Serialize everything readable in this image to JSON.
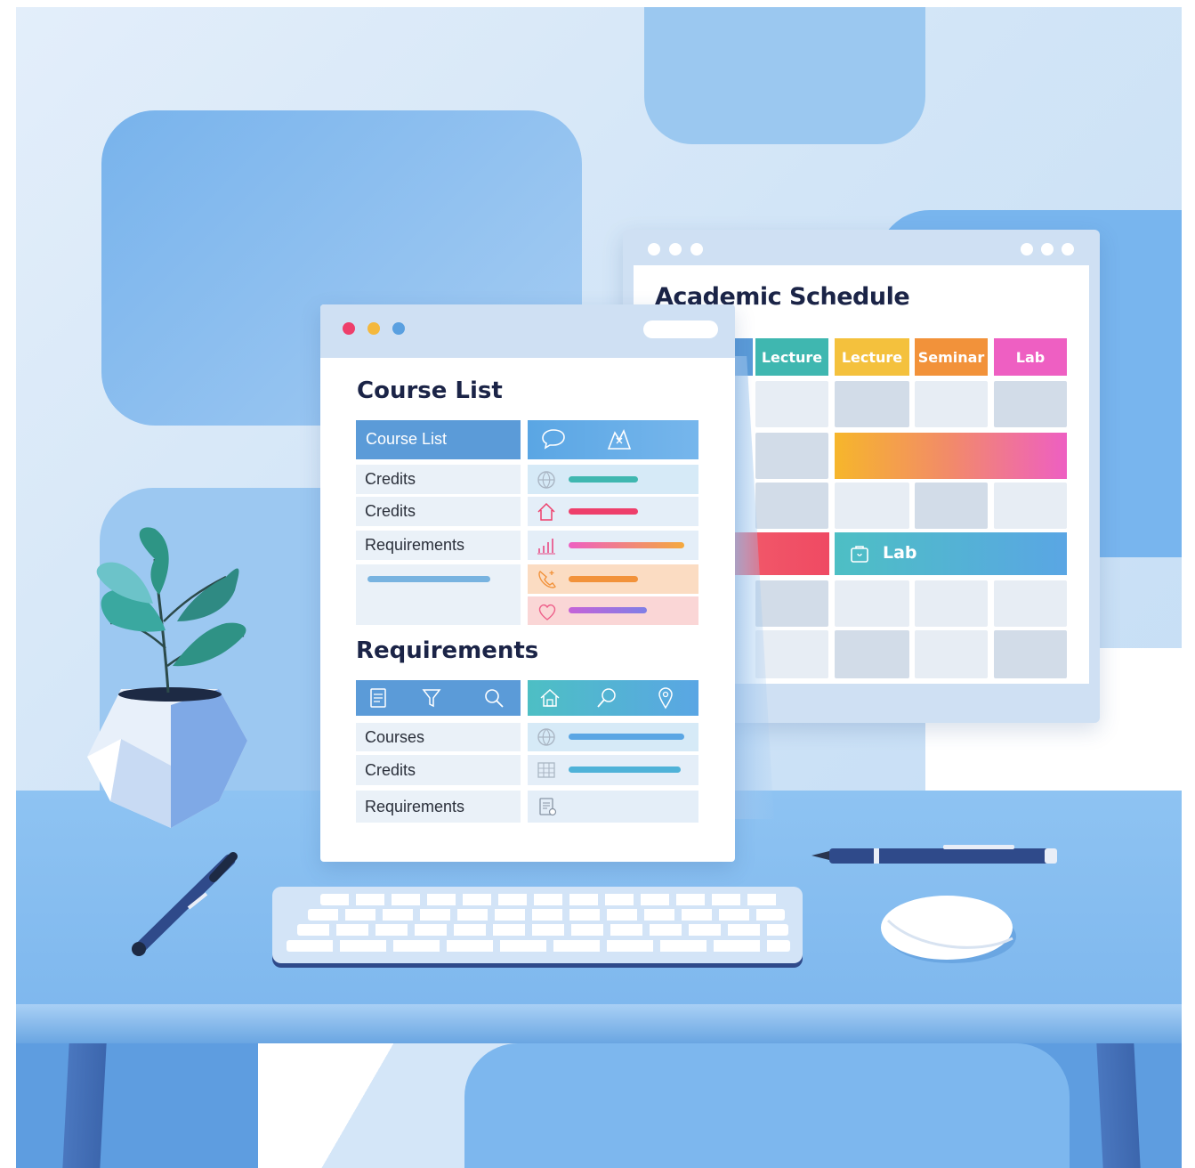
{
  "schedule_window": {
    "title": "Academic Schedule",
    "columns": [
      "Lecture",
      "Lecture",
      "Seminar",
      "Lab"
    ],
    "event_label": "Lab",
    "colors": {
      "lecture_teal": "#3fb7b0",
      "lecture_yellow": "#f4c13d",
      "seminar_orange": "#f2923a",
      "lab_pink": "#ee5fc2"
    }
  },
  "course_window": {
    "title": "Course List",
    "table_header": "Course List",
    "rows": [
      "Credits",
      "Credits",
      "Requirements"
    ],
    "section_title": "Requirements",
    "section_rows": [
      "Courses",
      "Credits",
      "Requirements"
    ],
    "icons": [
      "chat-icon",
      "map-icon",
      "globe-icon",
      "home-icon",
      "chart-icon",
      "phone-icon",
      "heart-icon",
      "document-icon",
      "filter-icon",
      "search-icon",
      "house-icon",
      "magnifier-icon",
      "pin-icon",
      "clipboard-icon"
    ],
    "colors": {
      "header_blue": "#5b9bd8",
      "accent_teal": "#3fb7b0",
      "accent_pink": "#ee3f6b",
      "accent_orange": "#f2923a",
      "accent_purple": "#c562d8"
    }
  }
}
